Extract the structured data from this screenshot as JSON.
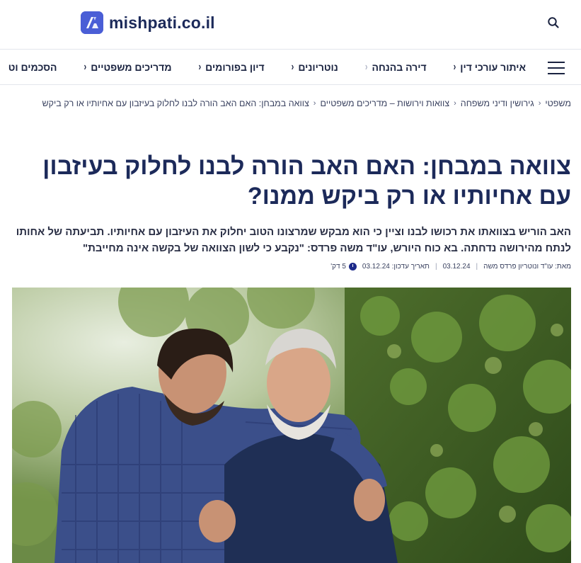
{
  "header": {
    "logo_text": "mishpati.co.il",
    "logo_icon": "logo-mark-icon",
    "search_icon": "search-icon",
    "brand_color": "#4a5ed6"
  },
  "nav": {
    "menu_icon": "hamburger-menu-icon",
    "items": [
      {
        "label": "איתור עורכי דין"
      },
      {
        "label": "דירה בהנחה"
      },
      {
        "label": "נוטריונים"
      },
      {
        "label": "דיון בפורומים"
      },
      {
        "label": "מדריכים משפטיים"
      },
      {
        "label": "הסכמים וט"
      }
    ]
  },
  "breadcrumb": [
    {
      "label": "משפטי"
    },
    {
      "label": "גירושין ודיני משפחה"
    },
    {
      "label": "צוואות וירושות – מדריכים משפטיים"
    },
    {
      "label": "צוואה במבחן: האם האב הורה לבנו לחלוק בעיזבון עם אחיותיו או רק ביקש"
    }
  ],
  "article": {
    "title": "צוואה במבחן: האם האב הורה לבנו לחלוק בעיזבון עם אחיותיו או רק ביקש ממנו?",
    "lead": "האב הוריש בצוואתו את רכושו לבנו וציין כי הוא מבקש שמרצונו הטוב יחלוק את העיזבון עם אחיותיו. תביעתה של אחותו לנתח מהירושה נדחתה. בא כוח היורש, עו\"ד משה פרדס: \"נקבע כי לשון הצוואה של בקשה אינה מחייבת\"",
    "meta": {
      "author": "מאת: עו\"ד ונוטריון פרדס משה",
      "published": "03.12.24",
      "updated": "תאריך עדכון: 03.12.24",
      "read_time": "5 דק'",
      "clock_icon": "clock-icon"
    },
    "hero_image": "photo-young-man-embracing-elderly-father-outdoors"
  }
}
